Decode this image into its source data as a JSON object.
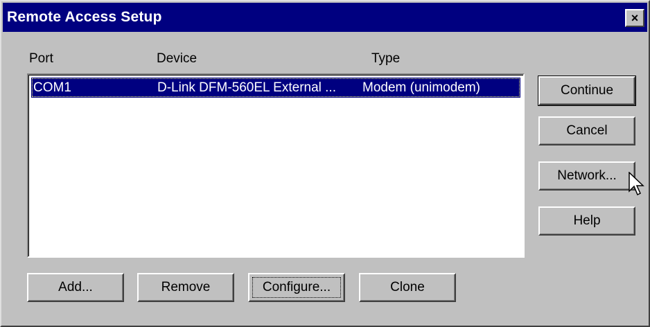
{
  "window": {
    "title": "Remote Access Setup",
    "close_glyph": "×"
  },
  "columns": {
    "port": "Port",
    "device": "Device",
    "type": "Type"
  },
  "ports": [
    {
      "port": "COM1",
      "device": "D-Link DFM-560EL External ...",
      "type": "Modem (unimodem)",
      "selected": true
    }
  ],
  "side_buttons": {
    "continue": "Continue",
    "cancel": "Cancel",
    "network": "Network...",
    "help": "Help"
  },
  "bottom_buttons": {
    "add": "Add...",
    "remove": "Remove",
    "configure": "Configure...",
    "clone": "Clone"
  },
  "colors": {
    "titlebar": "#000080",
    "face": "#c0c0c0",
    "selection": "#000080"
  }
}
